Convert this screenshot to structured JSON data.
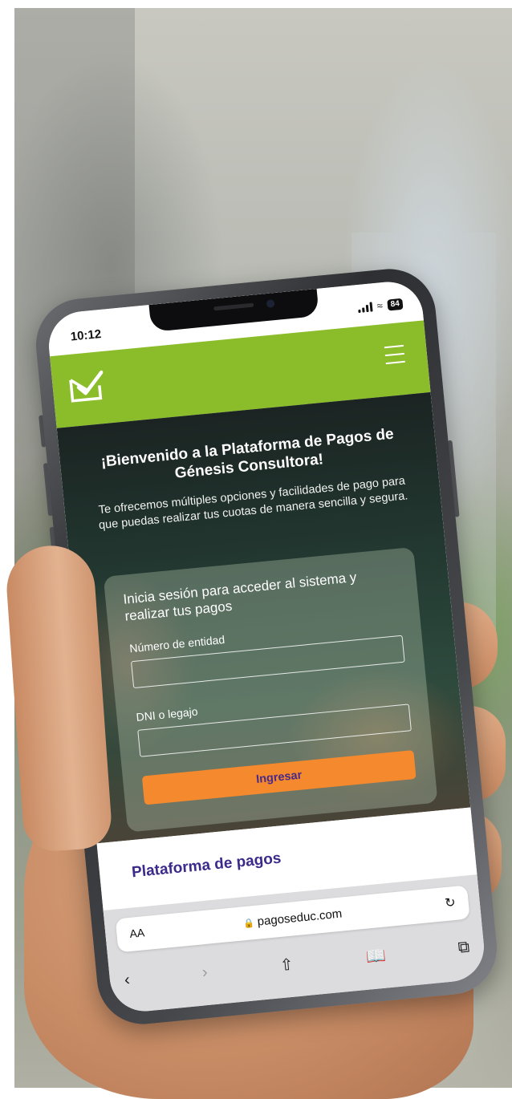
{
  "status_bar": {
    "time": "10:12",
    "battery": "84"
  },
  "site": {
    "brand_color": "#8bbd2a",
    "accent_color": "#f4892e",
    "title_color": "#3b2a8a",
    "logo_icon": "check-envelope-icon",
    "menu_icon": "hamburger-menu-icon"
  },
  "hero": {
    "title": "¡Bienvenido a la Plataforma de Pagos de Génesis Consultora!",
    "subtitle": "Te ofrecemos múltiples opciones y facilidades de pago para que puedas realizar tus cuotas de manera sencilla y segura."
  },
  "login": {
    "heading": "Inicia sesión para acceder al sistema y realizar tus pagos",
    "entity_label": "Número de entidad",
    "entity_value": "",
    "dni_label": "DNI o legajo",
    "dni_value": "",
    "submit_label": "Ingresar"
  },
  "section": {
    "title": "Plataforma de pagos"
  },
  "browser": {
    "text_size_label": "AA",
    "url": "pagoseduc.com",
    "icons": [
      "lock-icon",
      "reload-icon",
      "back-icon",
      "forward-icon",
      "share-icon",
      "bookmarks-icon",
      "tabs-icon"
    ]
  }
}
